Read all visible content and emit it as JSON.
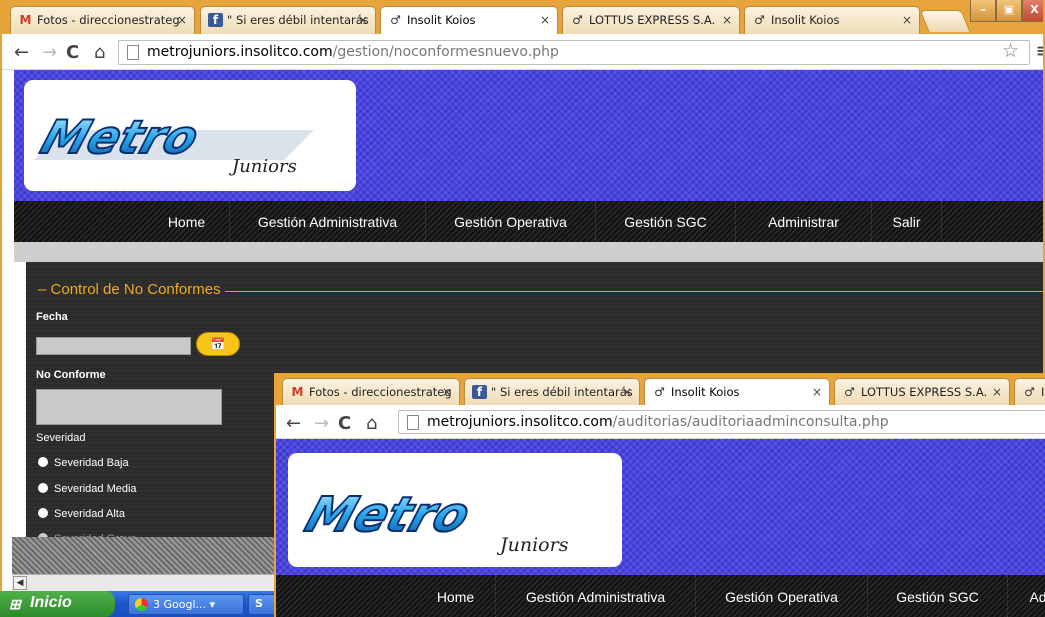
{
  "back_window": {
    "tabs": [
      {
        "label": "Fotos - direccionestrateg",
        "icon": "gmail-icon"
      },
      {
        "label": "\" Si eres débil intentarás",
        "icon": "facebook-icon"
      },
      {
        "label": "Insolit Koios",
        "icon": "insolit-icon"
      },
      {
        "label": "LOTTUS EXPRESS S.A.",
        "icon": "insolit-icon"
      },
      {
        "label": "Insolit Koios",
        "icon": "insolit-icon"
      }
    ],
    "url": {
      "host": "metrojuniors.insolitco.com",
      "path": "/gestion/noconformesnuevo.php"
    },
    "nav": [
      "Home",
      "Gestión Administrativa",
      "Gestión Operativa",
      "Gestión SGC",
      "Administrar",
      "Salir"
    ],
    "form": {
      "legend": "Control de No Conformes",
      "fecha_label": "Fecha",
      "no_conforme_label": "No Conforme",
      "severidad_label": "Severidad",
      "options": [
        "Severidad Baja",
        "Severidad Media",
        "Severidad Alta",
        "Severidad Grave"
      ]
    }
  },
  "front_window": {
    "tabs": [
      {
        "label": "Fotos - direccionestrateg",
        "icon": "gmail-icon"
      },
      {
        "label": "\" Si eres débil intentarás",
        "icon": "facebook-icon"
      },
      {
        "label": "Insolit Koios",
        "icon": "insolit-icon"
      },
      {
        "label": "LOTTUS EXPRESS S.A.",
        "icon": "insolit-icon"
      },
      {
        "label": "In",
        "icon": "insolit-icon"
      }
    ],
    "url": {
      "host": "metrojuniors.insolitco.com",
      "path": "/auditorias/auditoriaadminconsulta.php"
    },
    "nav": [
      "Home",
      "Gestión Administrativa",
      "Gestión Operativa",
      "Gestión SGC",
      "Ad"
    ]
  },
  "logo": {
    "main": "Metro",
    "sub": "Juniors"
  },
  "taskbar": {
    "start_label": "Inicio",
    "buttons": [
      {
        "label": "3 Googl...",
        "icon": "chrome-icon"
      },
      {
        "label": "S Sk",
        "icon": "skype-icon"
      }
    ]
  },
  "colors": {
    "accent": "#f0a820",
    "banner": "#4a45e6",
    "frame": "#e7a43c"
  }
}
